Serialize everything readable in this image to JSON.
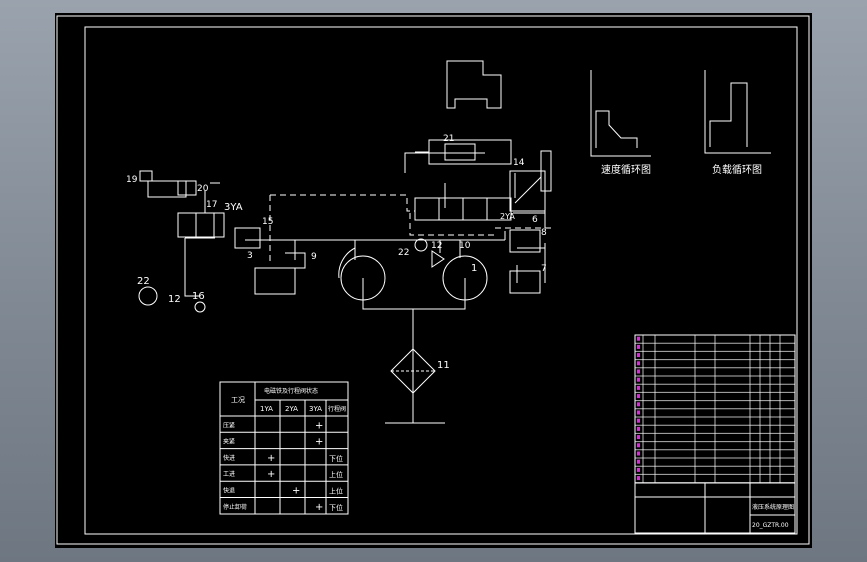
{
  "component_numbers": {
    "n1": "1",
    "n3": "3",
    "n6": "6",
    "n7": "7",
    "n8": "8",
    "n9": "9",
    "n10": "10",
    "n11": "11",
    "n12a": "12",
    "n12b": "12",
    "n14": "14",
    "n15": "15",
    "n16": "16",
    "n17": "17",
    "n19": "19",
    "n20": "20",
    "n21": "21",
    "n22a": "22",
    "n22b": "22",
    "n2ya": "2YA",
    "n3ya": "3YA"
  },
  "cycle_diagrams": {
    "speed_title": "速度循环图",
    "load_title": "负载循环图"
  },
  "action_table": {
    "col_process": "工况",
    "col_group": "电磁铁及行程阀状态",
    "col_1ya": "1YA",
    "col_2ya": "2YA",
    "col_3ya": "3YA",
    "col_valve": "行程阀",
    "rows": [
      {
        "name": "压紧",
        "c1": "",
        "c2": "",
        "c3": "+",
        "c4": ""
      },
      {
        "name": "夹紧",
        "c1": "",
        "c2": "",
        "c3": "+",
        "c4": ""
      },
      {
        "name": "快进",
        "c1": "+",
        "c2": "",
        "c3": "",
        "c4": "下位"
      },
      {
        "name": "工进",
        "c1": "+",
        "c2": "",
        "c3": "",
        "c4": "上位"
      },
      {
        "name": "快退",
        "c1": "",
        "c2": "+",
        "c3": "",
        "c4": "上位"
      },
      {
        "name": "停止卸荷",
        "c1": "",
        "c2": "",
        "c3": "+",
        "c4": "下位"
      }
    ]
  },
  "title_block": {
    "drawing_name": "液压系统原理图",
    "drawing_no": "20_GZTR.00"
  },
  "colors": {
    "sheet": "#000000",
    "lines": "#ffffff",
    "row_markers": "#cc33cc"
  }
}
